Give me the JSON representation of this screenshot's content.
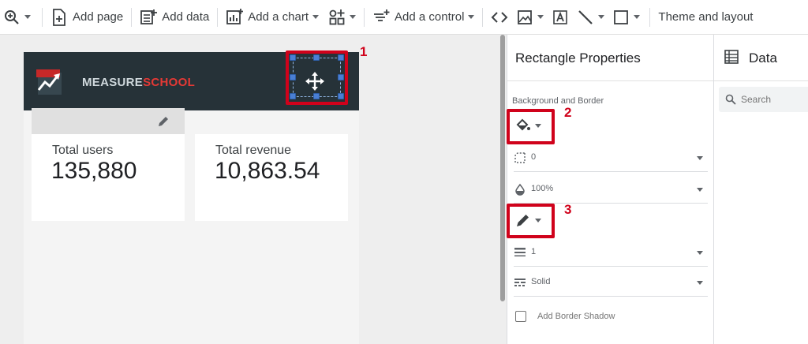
{
  "toolbar": {
    "add_page": "Add page",
    "add_data": "Add data",
    "add_chart": "Add a chart",
    "add_control": "Add a control",
    "theme_layout": "Theme and layout"
  },
  "report": {
    "logo_part1": "MEASURE",
    "logo_part2": "SCHOOL",
    "cards": [
      {
        "label": "Total users",
        "value": "135,880"
      },
      {
        "label": "Total revenue",
        "value": "10,863.54"
      }
    ]
  },
  "callouts": [
    "1",
    "2",
    "3"
  ],
  "properties": {
    "title": "Rectangle Properties",
    "section": "Background and Border",
    "border_radius": "0",
    "opacity": "100%",
    "border_weight": "1",
    "border_style": "Solid",
    "shadow_label": "Add Border Shadow",
    "shadow_checked": false
  },
  "data_panel": {
    "title": "Data",
    "search_placeholder": "Search"
  },
  "colors": {
    "header_bg": "#263238",
    "callout": "#d0021b",
    "selection": "#4a7fd4",
    "logo_red": "#e53935"
  }
}
